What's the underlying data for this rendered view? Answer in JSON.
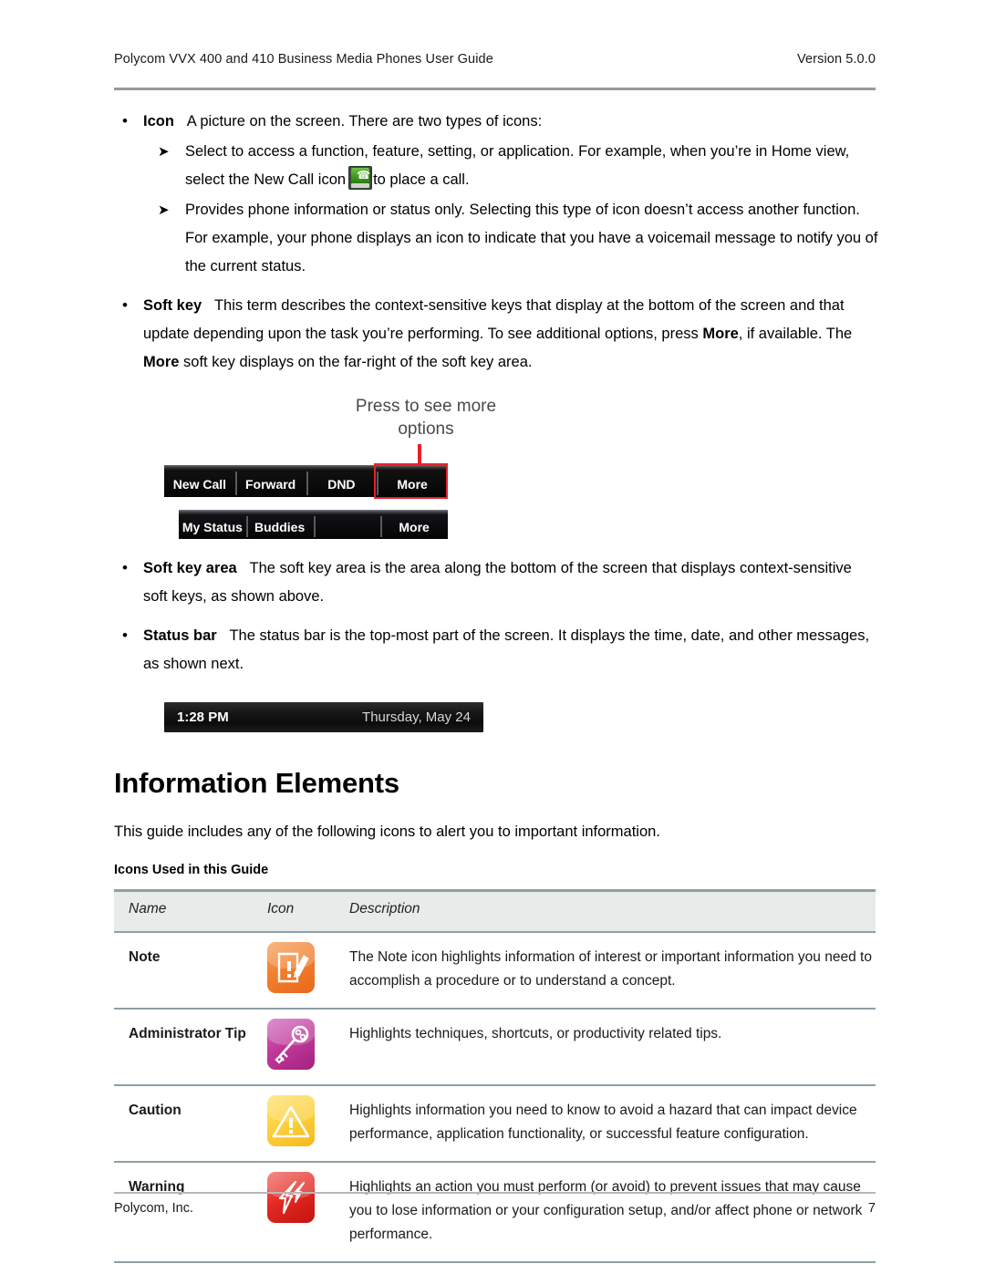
{
  "header": {
    "doc_title": "Polycom VVX 400 and 410 Business Media Phones User Guide",
    "version": "Version 5.0.0"
  },
  "footer": {
    "company": "Polycom, Inc.",
    "page_number": "7"
  },
  "body": {
    "icon_bullet": {
      "term": "Icon",
      "text": "A picture on the screen. There are two types of icons:",
      "sub1_before": "Select to access a function, feature, setting, or application. For example, when you’re in Home view, select the New Call icon",
      "sub1_after": "to place a call.",
      "sub1_icon_name": "new-call-icon",
      "sub2": "Provides phone information or status only. Selecting this type of icon doesn’t access another function. For example, your phone displays an icon to indicate that you have a voicemail message to notify you of the current status."
    },
    "softkey_bullet": {
      "term": "Soft key",
      "part1": "This term describes the context-sensitive keys that display at the bottom of the screen and that update depending upon the task you’re performing. To see additional options, press",
      "bold1": "More",
      "part2": ", if available. The",
      "bold2": "More",
      "part3": "soft key displays on the far-right of the soft key area."
    },
    "softkey_area_bullet": {
      "term": "Soft key area",
      "text": "The soft key area is the area along the bottom of the screen that displays context-sensitive soft keys, as shown above."
    },
    "status_bar_bullet": {
      "term": "Status bar",
      "text": "The status bar is the top-most part of the screen. It displays the time, date, and other messages, as shown next."
    }
  },
  "softkey_figure": {
    "callout": "Press to see more options",
    "bar1_keys": [
      "New Call",
      "Forward",
      "DND",
      "More"
    ],
    "bar2_keys": [
      "My Status",
      "Buddies",
      "",
      "More"
    ],
    "highlighted_key": "More",
    "highlight_color": "#e8202a"
  },
  "status_bar_figure": {
    "time": "1:28 PM",
    "date": "Thursday, May 24"
  },
  "section": {
    "heading": "Information Elements",
    "intro": "This guide includes any of the following icons to alert you to important information.",
    "table_caption": "Icons Used in this Guide"
  },
  "icons_table": {
    "columns": [
      "Name",
      "Icon",
      "Description"
    ],
    "rows": [
      {
        "name": "Note",
        "icon_name": "note-icon",
        "icon_color": "#e8671b",
        "description": "The Note icon highlights information of interest or important information you need to accomplish a procedure or to understand a concept."
      },
      {
        "name": "Administrator Tip",
        "icon_name": "key-icon",
        "icon_color": "#c23a9b",
        "description": "Highlights techniques, shortcuts, or productivity related tips."
      },
      {
        "name": "Caution",
        "icon_name": "warning-triangle-icon",
        "icon_color": "#fdd23f",
        "description": "Highlights information you need to know to avoid a hazard that can impact device performance, application functionality, or successful feature configuration."
      },
      {
        "name": "Warning",
        "icon_name": "lightning-bolt-icon",
        "icon_color": "#e32b24",
        "description": "Highlights an action you must perform (or avoid) to prevent issues that may cause you to lose information or your configuration setup, and/or affect phone or network performance."
      }
    ]
  }
}
